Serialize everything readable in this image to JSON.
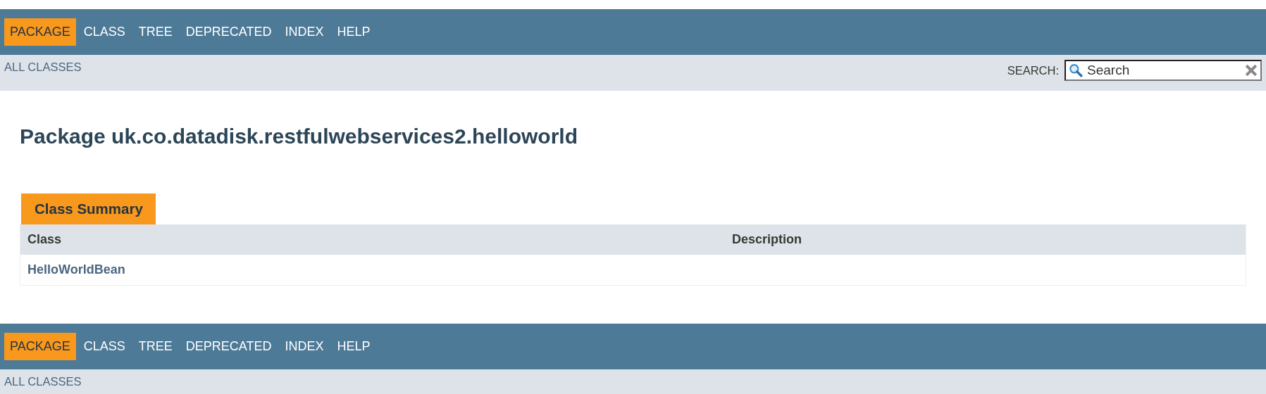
{
  "top_nav": {
    "items": [
      {
        "label": "PACKAGE",
        "selected": true
      },
      {
        "label": "CLASS",
        "selected": false
      },
      {
        "label": "TREE",
        "selected": false
      },
      {
        "label": "DEPRECATED",
        "selected": false
      },
      {
        "label": "INDEX",
        "selected": false
      },
      {
        "label": "HELP",
        "selected": false
      }
    ],
    "sub_link": "ALL CLASSES",
    "search": {
      "label": "SEARCH:",
      "placeholder": "Search"
    }
  },
  "title": "Package uk.co.datadisk.restfulwebservices2.helloworld",
  "summary": {
    "caption": "Class Summary",
    "columns": [
      "Class",
      "Description"
    ],
    "rows": [
      {
        "class": "HelloWorldBean"
      }
    ]
  },
  "bottom_nav": {
    "items": [
      {
        "label": "PACKAGE",
        "selected": true
      },
      {
        "label": "CLASS",
        "selected": false
      },
      {
        "label": "TREE",
        "selected": false
      },
      {
        "label": "DEPRECATED",
        "selected": false
      },
      {
        "label": "INDEX",
        "selected": false
      },
      {
        "label": "HELP",
        "selected": false
      }
    ],
    "sub_link": "ALL CLASSES"
  }
}
